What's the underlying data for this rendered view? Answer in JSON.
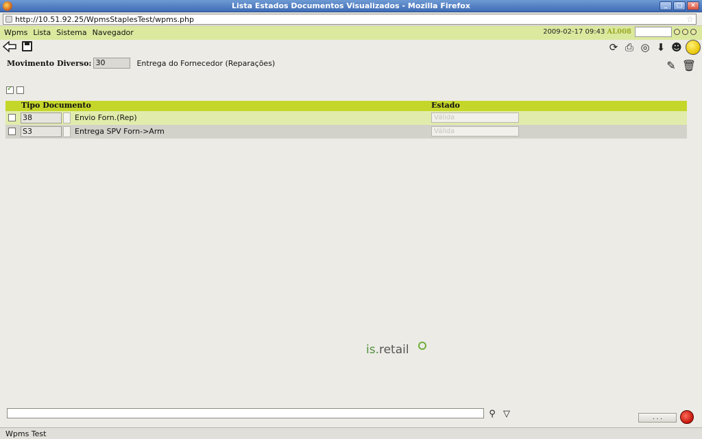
{
  "window": {
    "title": "Lista Estados Documentos Visualizados - Mozilla Firefox"
  },
  "browser": {
    "url": "http://10.51.92.25/WpmsStaplesTest/wpms.php"
  },
  "menu": {
    "items": [
      "Wpms",
      "Lista",
      "Sistema",
      "Navegador"
    ]
  },
  "header": {
    "datetime": "2009-02-17 09:43",
    "user": "AL008"
  },
  "movimento": {
    "label": "Movimento Diverso:",
    "code": "30",
    "description": "Entrega do Fornecedor (Reparações)"
  },
  "table": {
    "columns": [
      "Tipo Documento",
      "Estado"
    ],
    "rows": [
      {
        "code": "38",
        "name": "Envio Forn.(Rep)",
        "state": "Válida"
      },
      {
        "code": "S3",
        "name": "Entrega SPV Forn->Arm",
        "state": "Válida"
      }
    ]
  },
  "logo": {
    "prefix": "is.",
    "suffix": "retail"
  },
  "footer": {
    "more_label": ". . ."
  },
  "status": {
    "text": "Wpms Test"
  },
  "colors": {
    "menubar": "#dbe99e",
    "table_header": "#c5d62a",
    "row_even": "#e1ecac",
    "row_odd": "#d2d1ca"
  }
}
